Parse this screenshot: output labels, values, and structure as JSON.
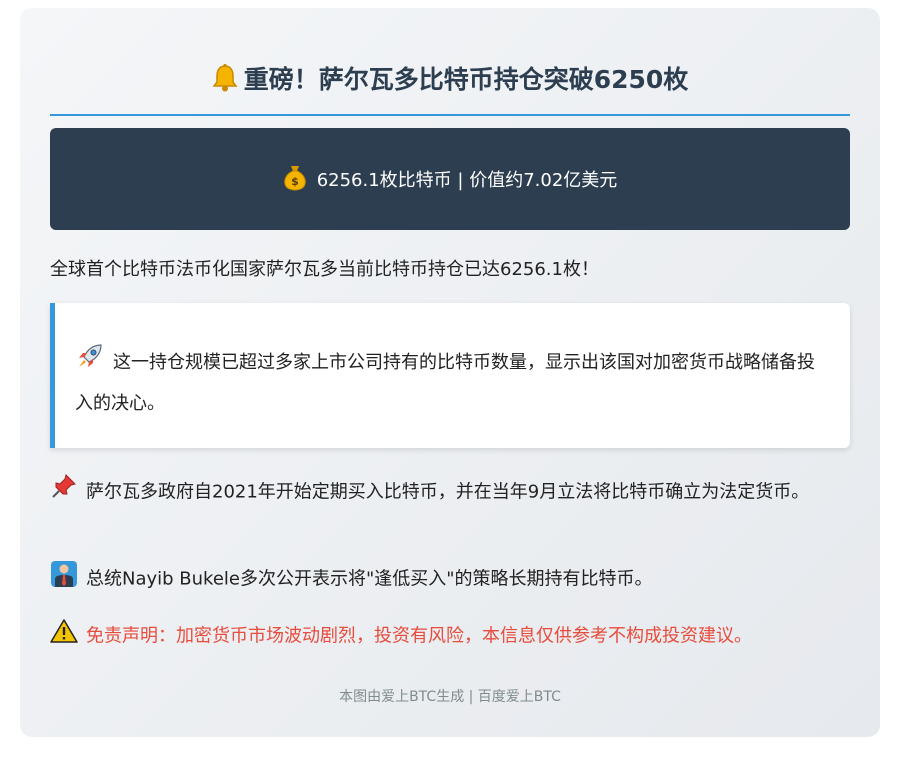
{
  "header": {
    "title": "重磅！萨尔瓦多比特币持仓突破6250枚",
    "icon": "bell-icon",
    "accent_color": "#3498db",
    "title_color": "#2c3e50"
  },
  "banner": {
    "text": "6256.1枚比特币 | 价值约7.02亿美元",
    "icon": "money-bag-icon",
    "background": "#2c3e50"
  },
  "intro": {
    "text": "全球首个比特币法币化国家萨尔瓦多当前比特币持仓已达6256.1枚！"
  },
  "highlight": {
    "icon": "rocket-icon",
    "text": "这一持仓规模已超过多家上市公司持有的比特币数量，显示出该国对加密货币战略储备投入的决心。"
  },
  "points": [
    {
      "icon": "pushpin-icon",
      "text": "萨尔瓦多政府自2021年开始定期买入比特币，并在当年9月立法将比特币确立为法定货币。"
    },
    {
      "icon": "person-icon",
      "text": "总统Nayib Bukele多次公开表示将\"逢低买入\"的策略长期持有比特币。"
    }
  ],
  "disclaimer": {
    "icon": "warning-icon",
    "text": "免责声明：加密货币市场波动剧烈，投资有风险，本信息仅供参考不构成投资建议。",
    "color": "#e74c3c"
  },
  "footer": {
    "text": "本图由爱上BTC生成 | 百度爱上BTC"
  }
}
